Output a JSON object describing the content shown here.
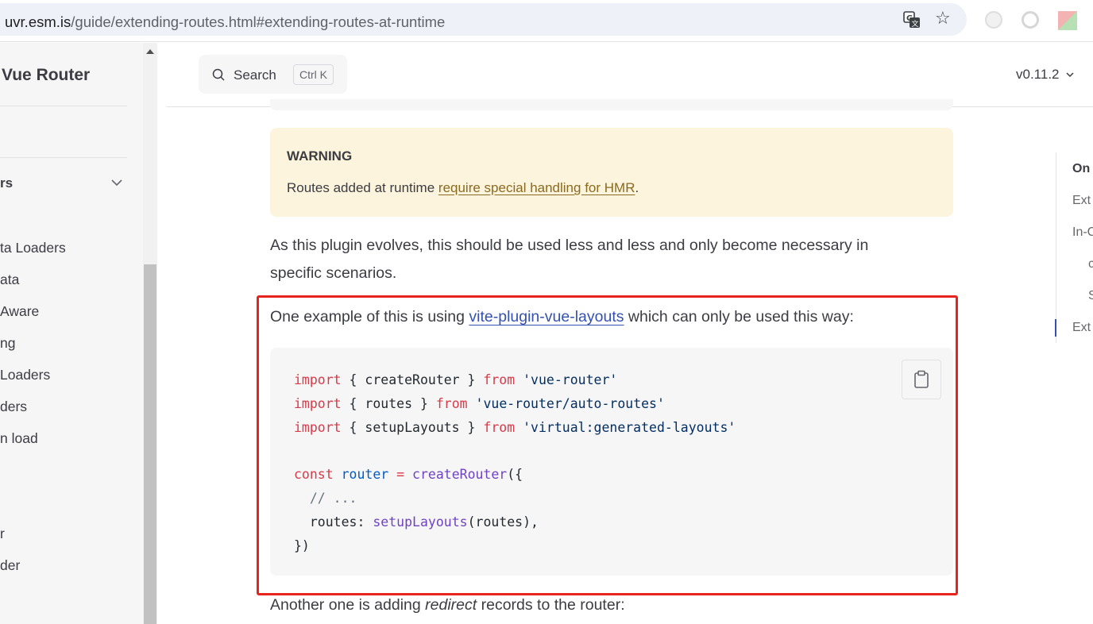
{
  "browser": {
    "url_domain": "uvr.esm.is",
    "url_path": "/guide/extending-routes.html#extending-routes-at-runtime"
  },
  "sidebar": {
    "brand": "Vue Router",
    "group": "rs",
    "items": [
      "ta Loaders",
      "ata",
      "Aware",
      "ng",
      "Loaders",
      "ders",
      "n load",
      "r",
      "der"
    ]
  },
  "nav": {
    "search_label": "Search",
    "search_shortcut": "Ctrl K",
    "version": "v0.11.2"
  },
  "warning": {
    "title": "WARNING",
    "text_before": "Routes added at runtime ",
    "link": "require special handling for HMR",
    "text_after": "."
  },
  "content": {
    "para1_line1": "As this plugin evolves, this should be used less and less and only become necessary in",
    "para1_line2": "specific scenarios.",
    "para2_before": "One example of this is using ",
    "para2_link": "vite-plugin-vue-layouts",
    "para2_after": " which can only be used this way:",
    "para3_before": "Another one is adding ",
    "para3_em": "redirect",
    "para3_after": " records to the router:"
  },
  "code": {
    "l1": {
      "kw": "import",
      "mid": " { createRouter } ",
      "from": "from",
      "str": "'vue-router'"
    },
    "l2": {
      "kw": "import",
      "mid": " { routes } ",
      "from": "from",
      "str": "'vue-router/auto-routes'"
    },
    "l3": {
      "kw": "import",
      "mid": " { setupLayouts } ",
      "from": "from",
      "str": "'virtual:generated-layouts'"
    },
    "l5": {
      "kw": "const",
      "var": "router",
      "eq": " = ",
      "fn": "createRouter",
      "rest": "({"
    },
    "l6": {
      "cmt": "// ..."
    },
    "l7": {
      "key": "routes: ",
      "fn": "setupLayouts",
      "rest": "(routes),"
    },
    "l8": {
      "rest": "})"
    }
  },
  "outline": {
    "title": "On",
    "items": [
      "Ext",
      "In-C",
      "c",
      "S",
      "Ext"
    ]
  },
  "colors": {
    "accent": "#3451b2",
    "warning_bg": "#fcf4dc",
    "highlight": "#e8221d"
  }
}
